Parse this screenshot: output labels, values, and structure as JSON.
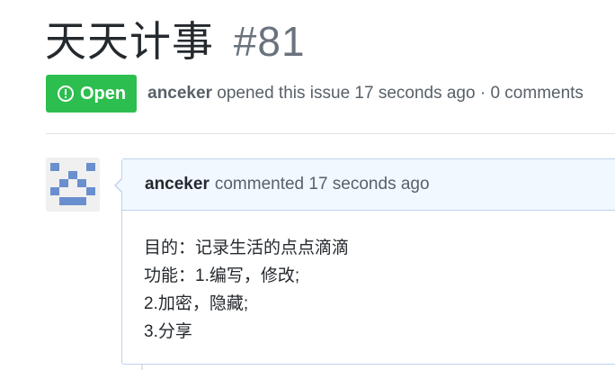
{
  "issue": {
    "title": "天天计事",
    "number": "#81",
    "state": "Open",
    "author": "anceker",
    "opened_text": "opened this issue 17 seconds ago · 0 comments"
  },
  "comment": {
    "author": "anceker",
    "meta": "commented 17 seconds ago",
    "body_lines": [
      "目的：记录生活的点点滴滴",
      "功能：1.编写，修改;",
      "2.加密，隐藏;",
      "3.分享"
    ]
  },
  "colors": {
    "open_badge": "#2cbe4e",
    "comment_header_bg": "#f1f8ff",
    "comment_border": "#c0d3eb",
    "avatar_pattern": "#6a8fce"
  },
  "icons": {
    "state": "issue-opened-icon",
    "avatar": "identicon"
  }
}
